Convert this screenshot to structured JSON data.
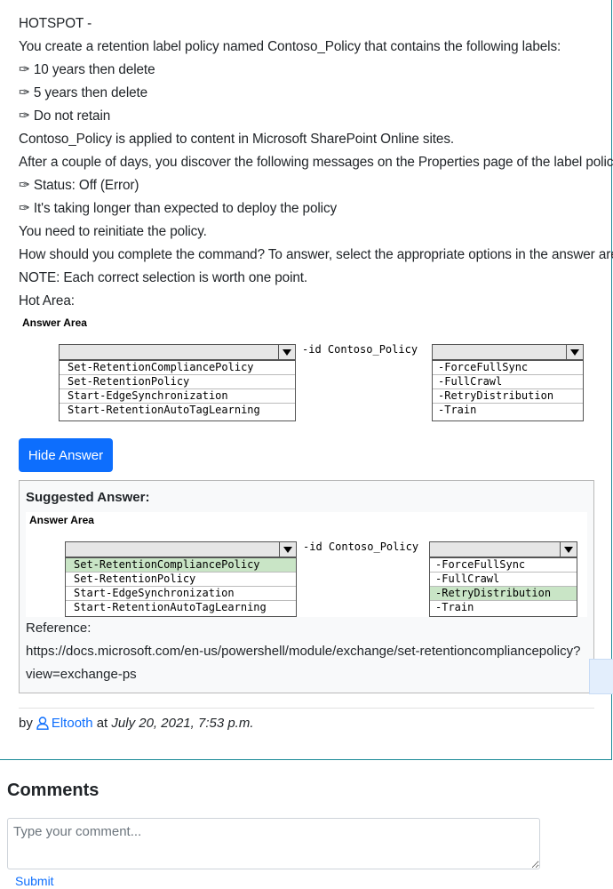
{
  "question": {
    "lines": [
      "HOTSPOT -",
      "You create a retention label policy named Contoso_Policy that contains the following labels:",
      "✑ 10 years then delete",
      "✑ 5 years then delete",
      "✑ Do not retain",
      "Contoso_Policy is applied to content in Microsoft SharePoint Online sites.",
      "After a couple of days, you discover the following messages on the Properties page of the label policy:",
      "✑ Status: Off (Error)",
      "✑ It's taking longer than expected to deploy the policy",
      "You need to reinitiate the policy.",
      "How should you complete the command? To answer, select the appropriate options in the answer area.",
      "NOTE: Each correct selection is worth one point.",
      "Hot Area:"
    ]
  },
  "answer_area": {
    "label": "Answer Area",
    "id_text": "-id Contoso_Policy",
    "cmdlets": [
      "Set-RetentionCompliancePolicy",
      "Set-RetentionPolicy",
      "Start-EdgeSynchronization",
      "Start-RetentionAutoTagLearning"
    ],
    "switches": [
      "-ForceFullSync",
      "-FullCrawl",
      "-RetryDistribution",
      "-Train"
    ]
  },
  "hide_button": "Hide Answer",
  "suggested": {
    "title": "Suggested Answer:",
    "area_label": "Answer Area",
    "id_text": "-id Contoso_Policy",
    "cmdlets": [
      "Set-RetentionCompliancePolicy",
      "Set-RetentionPolicy",
      "Start-EdgeSynchronization",
      "Start-RetentionAutoTagLearning"
    ],
    "switches": [
      "-ForceFullSync",
      "-FullCrawl",
      "-RetryDistribution",
      "-Train"
    ],
    "selected_cmdlet": "Set-RetentionCompliancePolicy",
    "selected_switch": "-RetryDistribution",
    "highlight_color": "#c9e5c6",
    "reference_label": "Reference:",
    "reference_url_line1": "https://docs.microsoft.com/en-us/powershell/module/exchange/set-retentioncompliancepolicy?",
    "reference_url_line2": "view=exchange-ps"
  },
  "byline": {
    "prefix": "by",
    "author": "Eltooth",
    "at": "at",
    "date": "July 20, 2021, 7:53 p.m."
  },
  "comments": {
    "title": "Comments",
    "placeholder": "Type your comment...",
    "submit": "Submit"
  },
  "colors": {
    "accent": "#0d6efd",
    "card_border": "#1b8a98"
  }
}
